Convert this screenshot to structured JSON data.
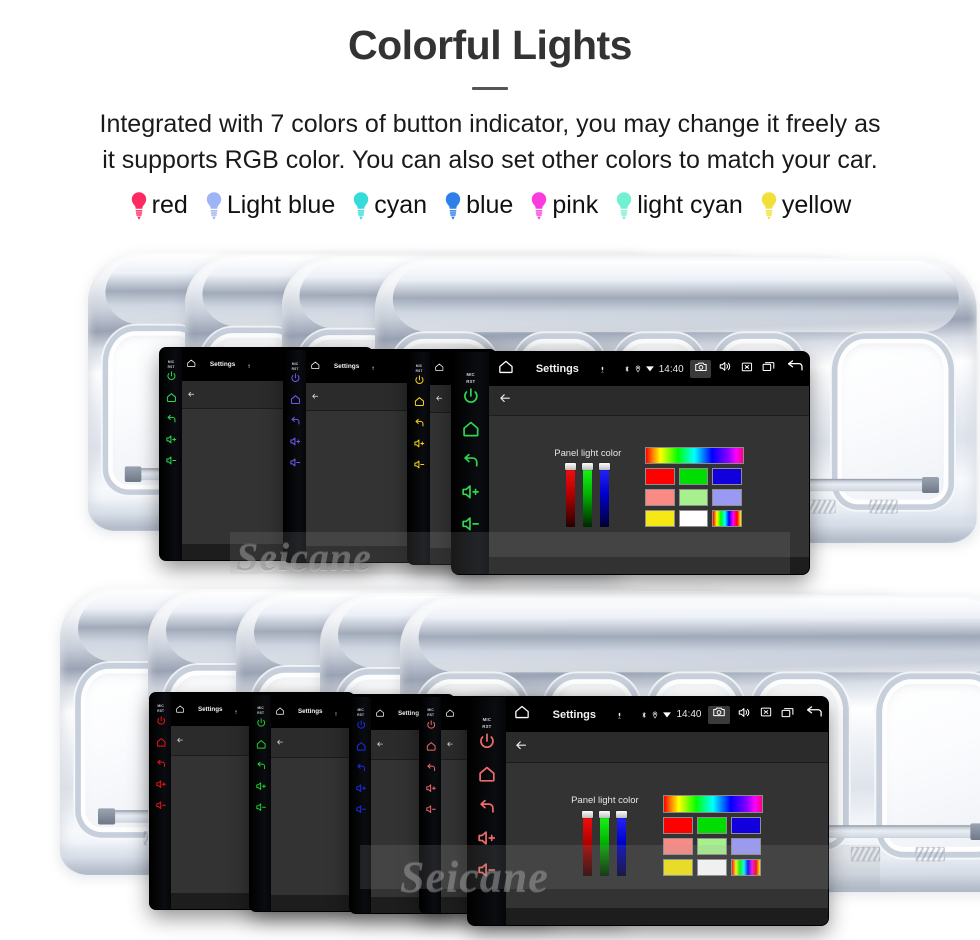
{
  "header": {
    "title": "Colorful Lights",
    "subtitle_line1": "Integrated with 7 colors of button indicator, you may change it freely as",
    "subtitle_line2": "it supports RGB color. You can also set other colors to match your car."
  },
  "legend": {
    "items": [
      {
        "label": "red",
        "color": "#fb2a60",
        "icon": "bulb-icon"
      },
      {
        "label": "Light blue",
        "color": "#9fb4f5",
        "icon": "bulb-icon"
      },
      {
        "label": "cyan",
        "color": "#34dbd9",
        "icon": "bulb-icon"
      },
      {
        "label": "blue",
        "color": "#2f7fe8",
        "icon": "bulb-icon"
      },
      {
        "label": "pink",
        "color": "#f83ce0",
        "icon": "bulb-icon"
      },
      {
        "label": "light cyan",
        "color": "#73f0d2",
        "icon": "bulb-icon"
      },
      {
        "label": "yellow",
        "color": "#f2e03a",
        "icon": "bulb-icon"
      }
    ]
  },
  "device": {
    "status_bar": {
      "title": "Settings",
      "clock": "14:40",
      "icons": [
        "home-icon",
        "mic-icon",
        "bluetooth-icon",
        "location-icon",
        "wifi-icon",
        "camera-icon",
        "volume-icon",
        "mute-icon",
        "recents-icon",
        "back-icon"
      ]
    },
    "action_bar": {
      "back_icon": "back-arrow-icon"
    },
    "panel": {
      "label": "Panel light color",
      "sliders": [
        {
          "name": "red-slider",
          "color": "#ff1111",
          "value": 100
        },
        {
          "name": "green-slider",
          "color": "#1dff1d",
          "value": 100
        },
        {
          "name": "blue-slider",
          "color": "#2b2bff",
          "value": 100
        }
      ],
      "swatch_rows": [
        [
          {
            "name": "swatch-red",
            "color": "#ff0000"
          },
          {
            "name": "swatch-green",
            "color": "#00dd00"
          },
          {
            "name": "swatch-blue",
            "color": "#1100dd"
          }
        ],
        [
          {
            "name": "swatch-salmon",
            "color": "#f98a84"
          },
          {
            "name": "swatch-lightgreen",
            "color": "#a6f08e"
          },
          {
            "name": "swatch-periwinkle",
            "color": "#9a9af5"
          }
        ],
        [
          {
            "name": "swatch-yellow",
            "color": "#f6e815"
          },
          {
            "name": "swatch-white",
            "color": "#ffffff"
          },
          {
            "name": "swatch-rainbow",
            "color": "rainbow"
          }
        ]
      ]
    },
    "side_keys": {
      "mic_label": "MIC",
      "reset_label": "RST",
      "icons": [
        "power-icon",
        "home-icon",
        "back-icon",
        "volume-up-icon",
        "volume-down-icon"
      ]
    }
  },
  "units": {
    "top_row": [
      {
        "name": "head-unit-green",
        "key_color": "#2fd44f"
      },
      {
        "name": "head-unit-purple",
        "key_color": "#6a5cf0"
      },
      {
        "name": "head-unit-yellow",
        "key_color": "#f2d21a"
      },
      {
        "name": "head-unit-main",
        "key_color": "#2fd44f"
      }
    ],
    "bottom_row": [
      {
        "name": "head-unit-red",
        "key_color": "#f01515"
      },
      {
        "name": "head-unit-green",
        "key_color": "#1fd22f"
      },
      {
        "name": "head-unit-blue",
        "key_color": "#1b2df0"
      },
      {
        "name": "head-unit-pink",
        "key_color": "#f06a6a"
      },
      {
        "name": "head-unit-main",
        "key_color": "#f06a6a"
      }
    ]
  },
  "watermark": {
    "text": "Seicane"
  }
}
